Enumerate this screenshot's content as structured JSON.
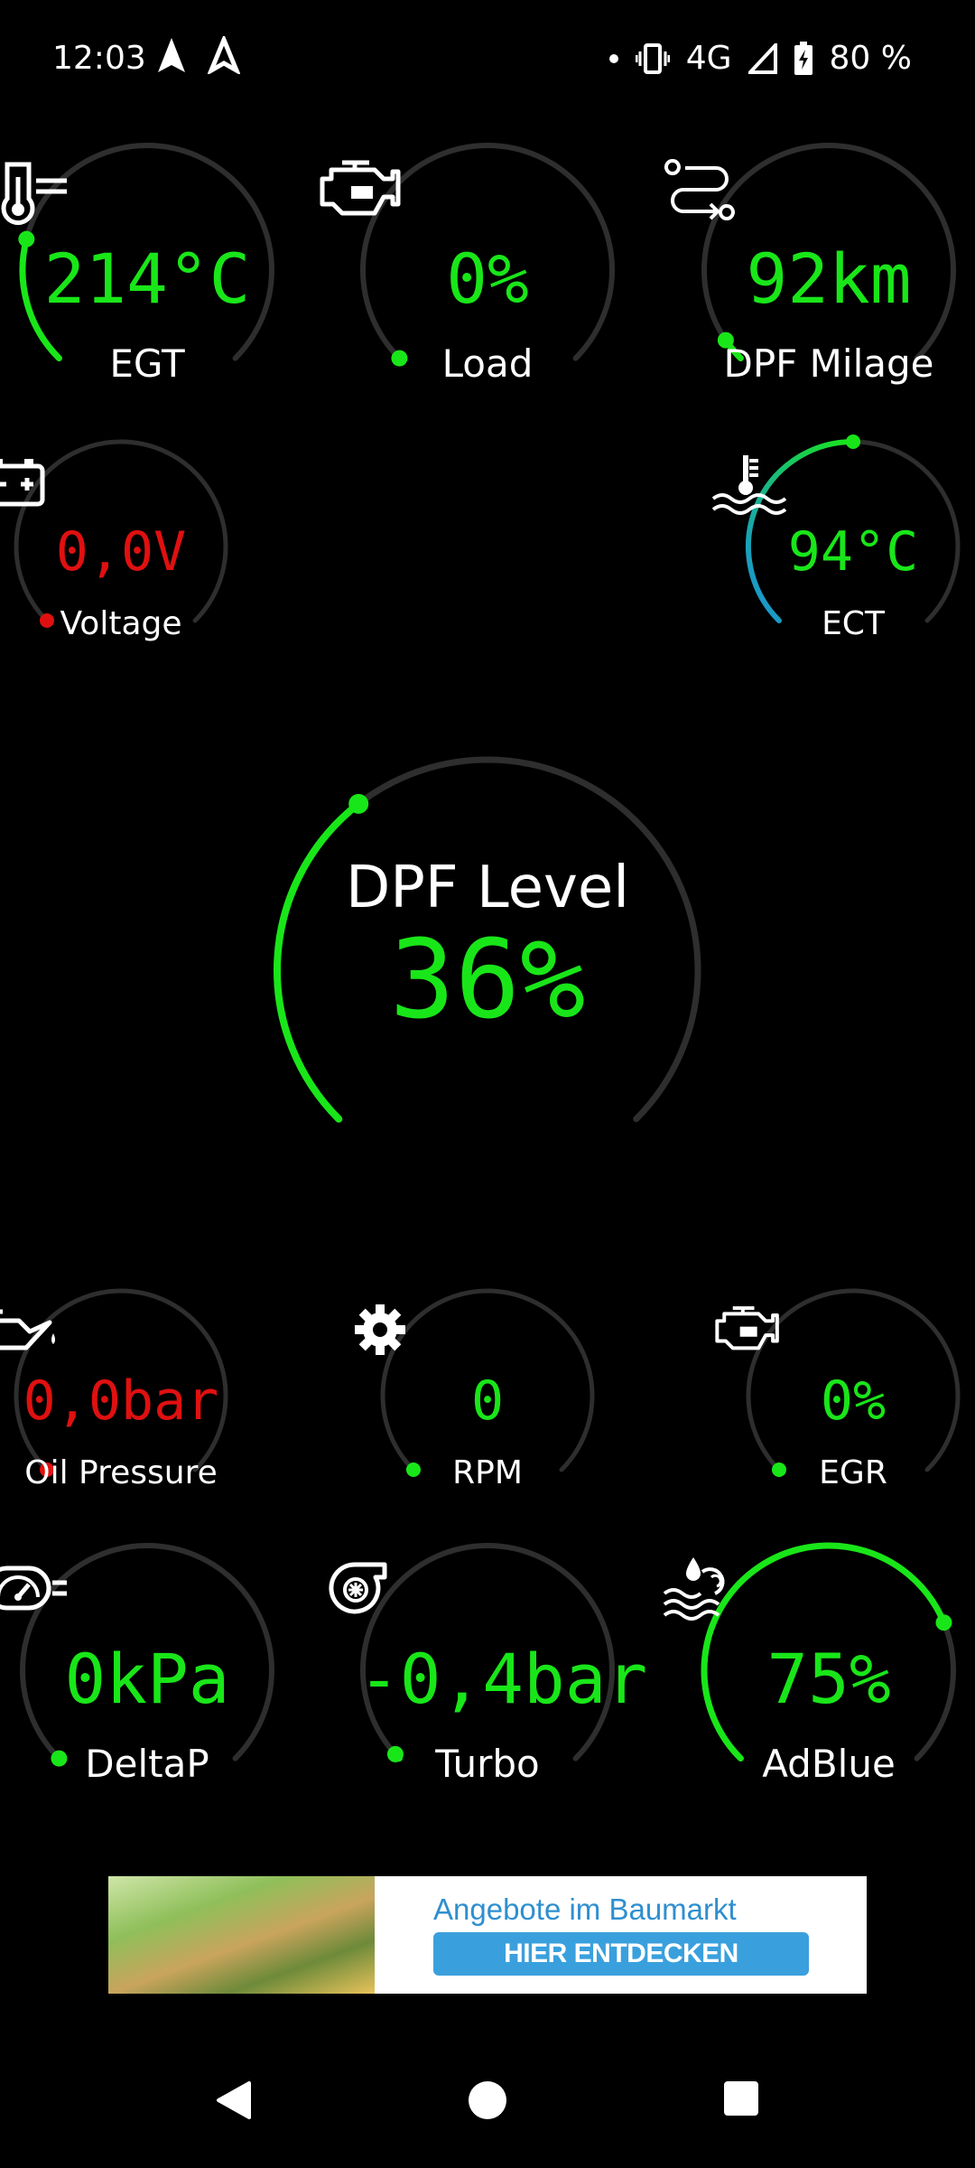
{
  "status_bar": {
    "time": "12:03",
    "network": "4G",
    "battery": "80 %",
    "icons": [
      "navigation-icon",
      "navigation-outline-icon",
      "dot-icon",
      "vibrate-icon",
      "signal-icon",
      "battery-icon"
    ]
  },
  "colors": {
    "green": "#19e619",
    "red": "#e01010",
    "track": "#2e2e2e",
    "blue": "#1a8fe0",
    "ad_blue": "#3aa0dd"
  },
  "gauges": {
    "egt": {
      "value": "214°C",
      "label": "EGT",
      "icon": "thermometer-icon",
      "level": 0.22
    },
    "load": {
      "value": "0%",
      "label": "Load",
      "icon": "engine-icon",
      "level": 0.0
    },
    "dpf_milage": {
      "value": "92km",
      "label": "DPF Milage",
      "icon": "route-icon",
      "level": 0.04
    },
    "voltage": {
      "value": "0,0V",
      "label": "Voltage",
      "icon": "battery-icon",
      "level": 0.0
    },
    "ect": {
      "value": "94°C",
      "label": "ECT",
      "icon": "coolant-temp-icon",
      "level": 0.5
    },
    "dpf_level": {
      "title": "DPF Level",
      "value": "36%",
      "level": 0.36
    },
    "oil_pressure": {
      "value": "0,0bar",
      "label": "Oil Pressure",
      "icon": "oil-can-icon",
      "level": 0.0
    },
    "rpm": {
      "value": "0",
      "label": "RPM",
      "icon": "gear-icon",
      "level": 0.0
    },
    "egr": {
      "value": "0%",
      "label": "EGR",
      "icon": "engine-icon",
      "level": 0.0
    },
    "deltap": {
      "value": "0kPa",
      "label": "DeltaP",
      "icon": "speedometer-icon",
      "level": 0.0
    },
    "turbo": {
      "value": "-0,4bar",
      "label": "Turbo",
      "icon": "turbo-icon",
      "level": 0.01
    },
    "adblue": {
      "value": "75%",
      "label": "AdBlue",
      "icon": "adblue-icon",
      "level": 0.75
    }
  },
  "ad": {
    "title": "Angebote im Baumarkt",
    "button": "HIER ENTDECKEN"
  },
  "nav": {
    "icons": [
      "back-icon",
      "home-icon",
      "recents-icon"
    ]
  }
}
